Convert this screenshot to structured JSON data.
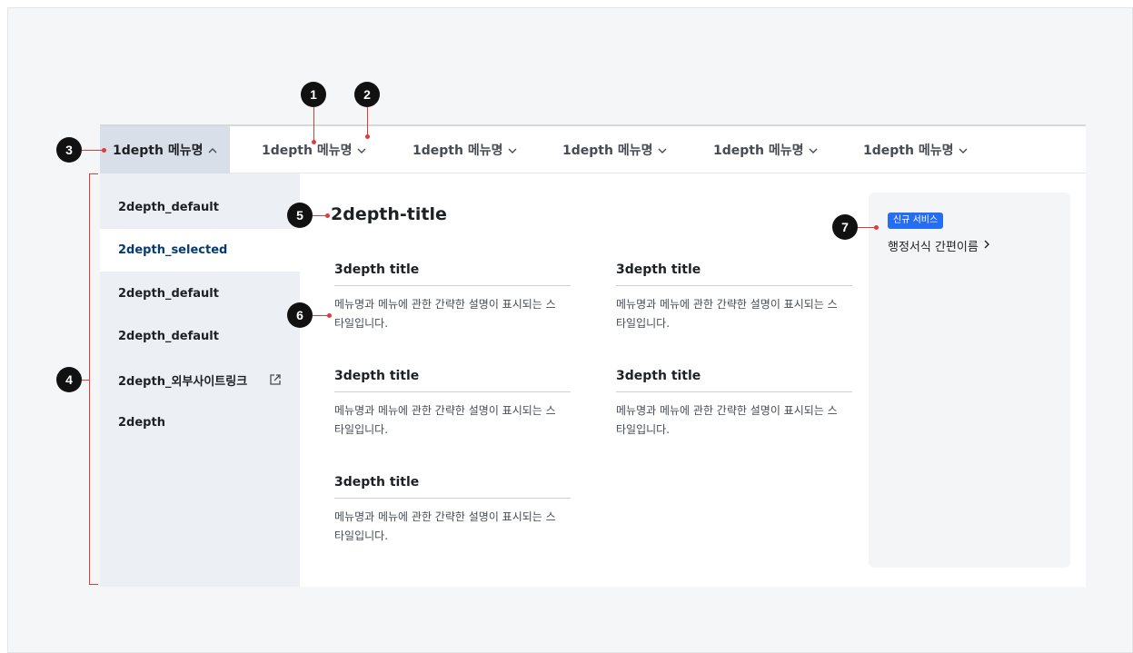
{
  "gnb": {
    "items": [
      {
        "label": "1depth 메뉴명",
        "chevron": "^",
        "active": true
      },
      {
        "label": "1depth 메뉴명",
        "chevron": "v"
      },
      {
        "label": "1depth 메뉴명",
        "chevron": "v"
      },
      {
        "label": "1depth 메뉴명",
        "chevron": "v"
      },
      {
        "label": "1depth 메뉴명",
        "chevron": "v"
      },
      {
        "label": "1depth 메뉴명",
        "chevron": "v"
      }
    ]
  },
  "side": {
    "items": [
      {
        "label": "2depth_default"
      },
      {
        "label": "2depth_selected",
        "selected": true
      },
      {
        "label": "2depth_default"
      },
      {
        "label": "2depth_default"
      },
      {
        "label": "2depth_외부사이트링크",
        "icon": "external-link-icon"
      },
      {
        "label": "2depth"
      }
    ]
  },
  "content": {
    "title": "2depth-title",
    "cards": [
      {
        "title": "3depth title",
        "desc": "메뉴명과 메뉴에 관한 간략한 설명이 표시되는 스타일입니다."
      },
      {
        "title": "3depth title",
        "desc": "메뉴명과 메뉴에 관한 간략한 설명이 표시되는 스타일입니다."
      },
      {
        "title": "3depth title",
        "desc": "메뉴명과 메뉴에 관한 간략한 설명이 표시되는 스타일입니다."
      },
      {
        "title": "3depth title",
        "desc": "메뉴명과 메뉴에 관한 간략한 설명이 표시되는 스타일입니다."
      },
      {
        "title": "3depth title",
        "desc": "메뉴명과 메뉴에 관한 간략한 설명이 표시되는 스타일입니다."
      }
    ]
  },
  "aside": {
    "badge": "신규 서비스",
    "link": "행정서식 간편이름",
    "link_arrow": ">"
  },
  "markers": [
    "1",
    "2",
    "3",
    "4",
    "5",
    "6",
    "7"
  ],
  "colors": {
    "accent": "#256ef4",
    "selected_text": "#063a74",
    "annotation": "#e03a3a",
    "side_bg": "#eceff4"
  }
}
